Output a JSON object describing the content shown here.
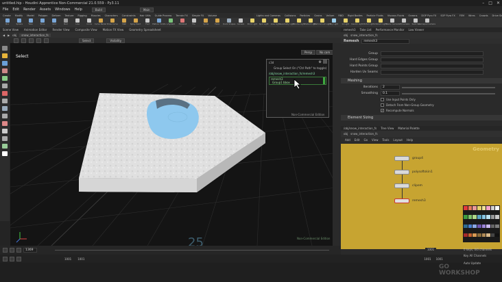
{
  "window": {
    "title": "untitled.hip - Houdini Apprentice Non-Commercial 21.0.559 - Py3.11"
  },
  "menu": {
    "items": [
      "File",
      "Edit",
      "Render",
      "Assets",
      "Windows",
      "Help"
    ],
    "build_label": "Build",
    "main_label": "Main"
  },
  "shelf": {
    "tabs_left": [
      "Create",
      "Modify",
      "Model",
      "Polygon",
      "Deform",
      "Texture",
      "Rigging",
      "Muscles",
      "Characters",
      "Constraints",
      "Hair Utils",
      "Guide Process",
      "Terrain FX",
      "Simple FX",
      "Volume"
    ],
    "tabs_right": [
      "Lights and Cameras",
      "Collisions",
      "Particles",
      "Grains",
      "Vellum",
      "RBD",
      "Rigid Bodies",
      "Particle Fluids",
      "Viscous Fluids",
      "Oceans",
      "DOP Pyro FX",
      "SOP Pyro FX",
      "FEM",
      "Wires",
      "Crowds",
      "Drive Simulation"
    ],
    "tools": [
      {
        "label": "Box",
        "color": "#7aa7d8"
      },
      {
        "label": "Sphere",
        "color": "#7aa7d8"
      },
      {
        "label": "Tube",
        "color": "#7aa7d8"
      },
      {
        "label": "Torus",
        "color": "#7aa7d8"
      },
      {
        "label": "Grid",
        "color": "#7aa7d8"
      },
      {
        "label": "Null",
        "color": "#9a9a9a"
      },
      {
        "label": "Line",
        "color": "#c8c8c8"
      },
      {
        "label": "Circle",
        "color": "#c8c8c8"
      },
      {
        "label": "Curve Bezier",
        "color": "#d6a54a"
      },
      {
        "label": "Draw Curve",
        "color": "#d6a54a"
      },
      {
        "label": "Path",
        "color": "#d6a54a"
      },
      {
        "label": "Spray Paint",
        "color": "#d6a54a"
      },
      {
        "label": "Font",
        "color": "#c8c8c8"
      },
      {
        "label": "Platonic Solids",
        "color": "#7aa7d8"
      },
      {
        "label": "L-System",
        "color": "#7bc47b"
      },
      {
        "label": "Metaball",
        "color": "#d77"
      },
      {
        "label": "File",
        "color": "#c8c8c8"
      },
      {
        "label": "Spiral",
        "color": "#d6a54a"
      },
      {
        "label": "Helix",
        "color": "#d6a54a"
      },
      {
        "label": "Quick Shapes",
        "color": "#9ab"
      },
      {
        "label": "Camera",
        "color": "#c8c8c8"
      },
      {
        "label": "Point Light",
        "color": "#e8d36a"
      },
      {
        "label": "Spot Light",
        "color": "#e8d36a"
      },
      {
        "label": "Area Light",
        "color": "#e8d36a"
      },
      {
        "label": "Geometry Light",
        "color": "#e8d36a"
      },
      {
        "label": "Volume Light",
        "color": "#e8d36a"
      },
      {
        "label": "Distant Light",
        "color": "#e8d36a"
      },
      {
        "label": "Environment Light",
        "color": "#e8d36a"
      },
      {
        "label": "Sky Light",
        "color": "#9cd0ee"
      },
      {
        "label": "GI Light",
        "color": "#e8d36a"
      },
      {
        "label": "Caustic Light",
        "color": "#e8d36a"
      },
      {
        "label": "Portal Light",
        "color": "#e8d36a"
      },
      {
        "label": "Ambient Light",
        "color": "#e8d36a"
      },
      {
        "label": "Stereo Camera",
        "color": "#c8c8c8"
      },
      {
        "label": "VR Camera",
        "color": "#c8c8c8"
      },
      {
        "label": "Switcher",
        "color": "#c8c8c8"
      },
      {
        "label": "Gamepad Camera",
        "color": "#c8c8c8"
      }
    ]
  },
  "left_panel": {
    "tabs": [
      "Scene View",
      "Animation Editor",
      "Render View",
      "Composite View",
      "Motion FX View",
      "Geometry Spreadsheet"
    ],
    "path": [
      "obj",
      "snow_interaction_fs"
    ],
    "select_chip": "Select",
    "visibility_chip": "Visibility",
    "mode_label": "Select",
    "persp_label": "Persp",
    "cam_label": "No cam",
    "watermark": "Non-Commercial Edition",
    "grid_number": "25",
    "group_popup": {
      "title": "Group Select On (\"Ctrl Path\" to toggle)",
      "path": "/obj/snow_interaction_fs/remesh3",
      "items": [
        "remesh3",
        "Group1 bbox"
      ],
      "footer": "Non-Commercial Edition",
      "header": "c3d"
    }
  },
  "timeline": {
    "frame_current": "1001",
    "start": "1001",
    "end": "1001",
    "range_start": "1001",
    "range_end": "1001",
    "frame_field": "1369",
    "marker_right": "1001"
  },
  "right_panel": {
    "tabs_top": [
      "remesh3",
      "Take List",
      "Performance Monitor",
      "Low Viewer"
    ],
    "main_label": "Main",
    "node_path": [
      "obj",
      "snow_interaction_fs"
    ],
    "node_type": "Remesh",
    "node_name": "remesh3",
    "params": [
      {
        "label": "Group",
        "value": ""
      },
      {
        "label": "Hard Edges Group",
        "value": ""
      },
      {
        "label": "Hard Points Group",
        "value": ""
      },
      {
        "label": "Harden Uv Seams",
        "value": ""
      }
    ],
    "section_meshing": "Meshing",
    "iterations_label": "Iterations",
    "iterations_value": "2",
    "smoothing_label": "Smoothing",
    "smoothing_value": "0.1",
    "checks": [
      {
        "label": "Use Input Points Only",
        "checked": false
      },
      {
        "label": "Detach From Non-Group Geometry",
        "checked": false
      },
      {
        "label": "Recompute Normals",
        "checked": true
      }
    ],
    "section_sizing": "Element Sizing",
    "net_tabs": [
      "/obj/snow_interaction_fs",
      "Tree View",
      "Material Palette"
    ],
    "net_menu": [
      "Add",
      "Edit",
      "Go",
      "View",
      "Tools",
      "Layout",
      "Help"
    ],
    "net_context": "Geometry",
    "nodes": [
      {
        "name": "group4"
      },
      {
        "name": "polysoftskin1"
      },
      {
        "name": "clipem"
      },
      {
        "name": "remesh3"
      }
    ],
    "bottom_info": "0 keys, 0/0 channels",
    "key_all": "Key All Channels",
    "auto_update": "Auto Update"
  },
  "colors": {
    "snow": "#e4e4e4",
    "water": "#8ec8ee",
    "network_bg": "#c7a431",
    "accent": "#e7b43a"
  },
  "swatches": [
    "#e23b3b",
    "#e8785a",
    "#ea9a9a",
    "#e6d26e",
    "#f1e39c",
    "#f4a3c9",
    "#d1d1d1",
    "#fbfbfb",
    "#3e9c3e",
    "#7fc46c",
    "#b0d98a",
    "#5aa3c4",
    "#86c6e6",
    "#b9e1f2",
    "#9a9a9a",
    "#c8c8c8",
    "#2d6a8f",
    "#4a7fd0",
    "#8aa7e6",
    "#6e55b0",
    "#9c85d8",
    "#c9b8ef",
    "#666",
    "#7d7d7d",
    "#a52a2a",
    "#c6622f",
    "#d99a53",
    "#8a6b3a",
    "#b08a55",
    "#d8b98a",
    "#444",
    "#111"
  ],
  "badge": {
    "line1": "GO",
    "line2": "WORKSHOP"
  }
}
